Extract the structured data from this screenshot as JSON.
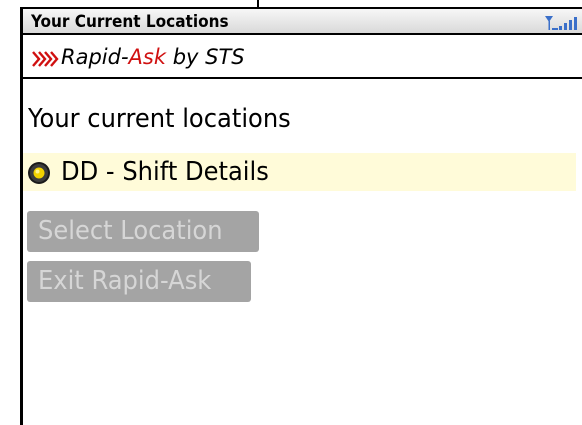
{
  "titlebar": {
    "title": "Your Current Locations",
    "signal_icon": "signal-strength-icon"
  },
  "brand": {
    "rapid": "Rapid-",
    "ask": "Ask",
    "by": " by STS",
    "accent_color": "#d01010"
  },
  "main": {
    "heading": "Your current locations",
    "locations": [
      {
        "label": "DD - Shift Details",
        "selected": true
      }
    ],
    "buttons": {
      "select_location": "Select Location",
      "exit": "Exit Rapid-Ask"
    }
  }
}
